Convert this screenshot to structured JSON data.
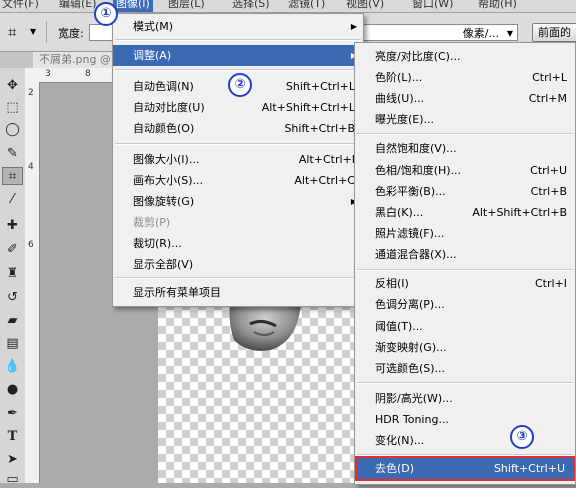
{
  "menubar": {
    "items": [
      "文件(F)",
      "编辑(E)",
      "图像(I)",
      "图层(L)",
      "选择(S)",
      "滤镜(T)",
      "视图(V)",
      "窗口(W)",
      "帮助(H)"
    ]
  },
  "optbar": {
    "width_label": "宽度:",
    "units_value": "像素/...",
    "front_image_button": "前面的"
  },
  "doc_tab": "不屑弟.png @",
  "ruler": {
    "h": [
      "3",
      "8"
    ],
    "v": [
      "2",
      "4",
      "6"
    ]
  },
  "image_menu": {
    "items": [
      {
        "label": "模式(M)",
        "shortcut": "",
        "submenu": true
      },
      {
        "label": "调整(A)",
        "shortcut": "",
        "submenu": true
      },
      {
        "label": "自动色调(N)",
        "shortcut": "Shift+Ctrl+L"
      },
      {
        "label": "自动对比度(U)",
        "shortcut": "Alt+Shift+Ctrl+L"
      },
      {
        "label": "自动颜色(O)",
        "shortcut": "Shift+Ctrl+B"
      },
      {
        "label": "图像大小(I)...",
        "shortcut": "Alt+Ctrl+I"
      },
      {
        "label": "画布大小(S)...",
        "shortcut": "Alt+Ctrl+C"
      },
      {
        "label": "图像旋转(G)",
        "shortcut": "",
        "submenu": true
      },
      {
        "label": "裁剪(P)",
        "shortcut": "",
        "disabled": true
      },
      {
        "label": "裁切(R)...",
        "shortcut": ""
      },
      {
        "label": "显示全部(V)",
        "shortcut": ""
      },
      {
        "label": "显示所有菜单项目",
        "shortcut": ""
      }
    ]
  },
  "adjust_menu": {
    "items": [
      {
        "label": "亮度/对比度(C)...",
        "shortcut": ""
      },
      {
        "label": "色阶(L)...",
        "shortcut": "Ctrl+L"
      },
      {
        "label": "曲线(U)...",
        "shortcut": "Ctrl+M"
      },
      {
        "label": "曝光度(E)...",
        "shortcut": ""
      },
      {
        "label": "自然饱和度(V)...",
        "shortcut": ""
      },
      {
        "label": "色相/饱和度(H)...",
        "shortcut": "Ctrl+U"
      },
      {
        "label": "色彩平衡(B)...",
        "shortcut": "Ctrl+B"
      },
      {
        "label": "黑白(K)...",
        "shortcut": "Alt+Shift+Ctrl+B"
      },
      {
        "label": "照片滤镜(F)...",
        "shortcut": ""
      },
      {
        "label": "通道混合器(X)...",
        "shortcut": ""
      },
      {
        "label": "反相(I)",
        "shortcut": "Ctrl+I"
      },
      {
        "label": "色调分离(P)...",
        "shortcut": ""
      },
      {
        "label": "阈值(T)...",
        "shortcut": ""
      },
      {
        "label": "渐变映射(G)...",
        "shortcut": ""
      },
      {
        "label": "可选颜色(S)...",
        "shortcut": ""
      },
      {
        "label": "阴影/高光(W)...",
        "shortcut": ""
      },
      {
        "label": "HDR Toning...",
        "shortcut": ""
      },
      {
        "label": "变化(N)...",
        "shortcut": ""
      },
      {
        "label": "去色(D)",
        "shortcut": "Shift+Ctrl+U"
      }
    ]
  },
  "annotations": [
    "①",
    "②",
    "③"
  ],
  "colors": {
    "highlight": "#3b69b2",
    "badge": "#1f3fc8",
    "box": "#e03030"
  }
}
